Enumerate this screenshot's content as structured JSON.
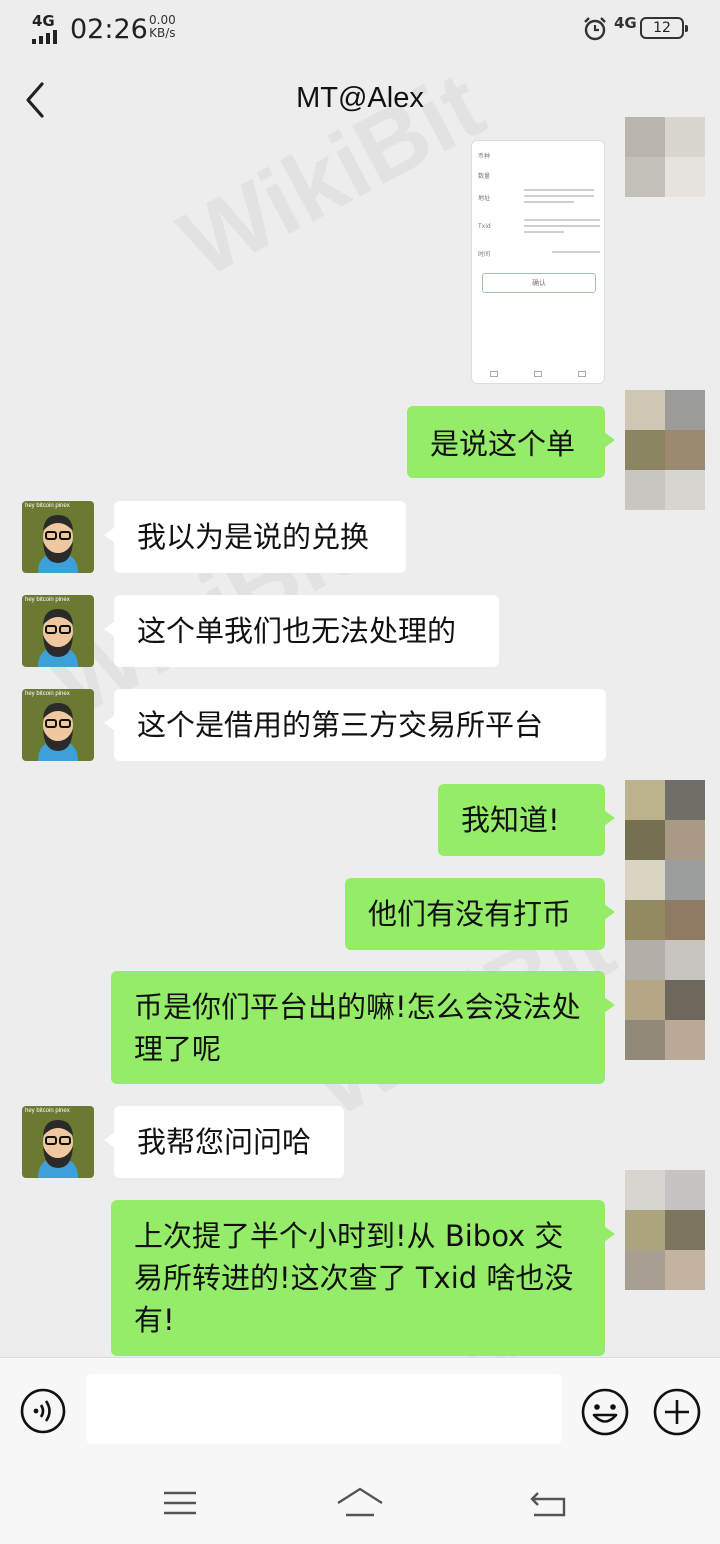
{
  "status_bar": {
    "network_left": "4G",
    "time": "02:26",
    "speed_value": "0.00",
    "speed_unit": "KB/s",
    "network_right": "4G",
    "battery": "12"
  },
  "header": {
    "title": "MT@Alex"
  },
  "watermark": "WikiBit",
  "avatar_tag": "hey bitcoin pinex",
  "messages": [
    {
      "from": "me",
      "text": "是说这个单"
    },
    {
      "from": "them",
      "text": "我以为是说的兑换"
    },
    {
      "from": "them",
      "text": "这个单我们也无法处理的"
    },
    {
      "from": "them",
      "text": "这个是借用的第三方交易所平台"
    },
    {
      "from": "me",
      "text": "我知道!"
    },
    {
      "from": "me",
      "text": "他们有没有打币"
    },
    {
      "from": "me",
      "text": "币是你们平台出的嘛!怎么会没法处理了呢"
    },
    {
      "from": "them",
      "text": "我帮您问问哈"
    },
    {
      "from": "me",
      "text": "上次提了半个小时到!从 Bibox 交易所转进的!这次查了 Txid 啥也没有!"
    }
  ],
  "shared_image": {
    "row_labels": [
      "币种",
      "数量",
      "地址",
      "Txid",
      "时间"
    ],
    "confirm_label": "确认"
  },
  "input_bar": {
    "placeholder": ""
  },
  "colors": {
    "my_bubble": "#95ec69",
    "their_bubble": "#ffffff",
    "background": "#ededed"
  },
  "icons": {
    "back": "back-chevron-icon",
    "voice": "voice-icon",
    "emoji": "emoji-icon",
    "more": "plus-icon",
    "alarm": "alarm-clock-icon",
    "nav_menu": "menu-icon",
    "nav_home": "home-icon",
    "nav_back": "back-icon"
  }
}
